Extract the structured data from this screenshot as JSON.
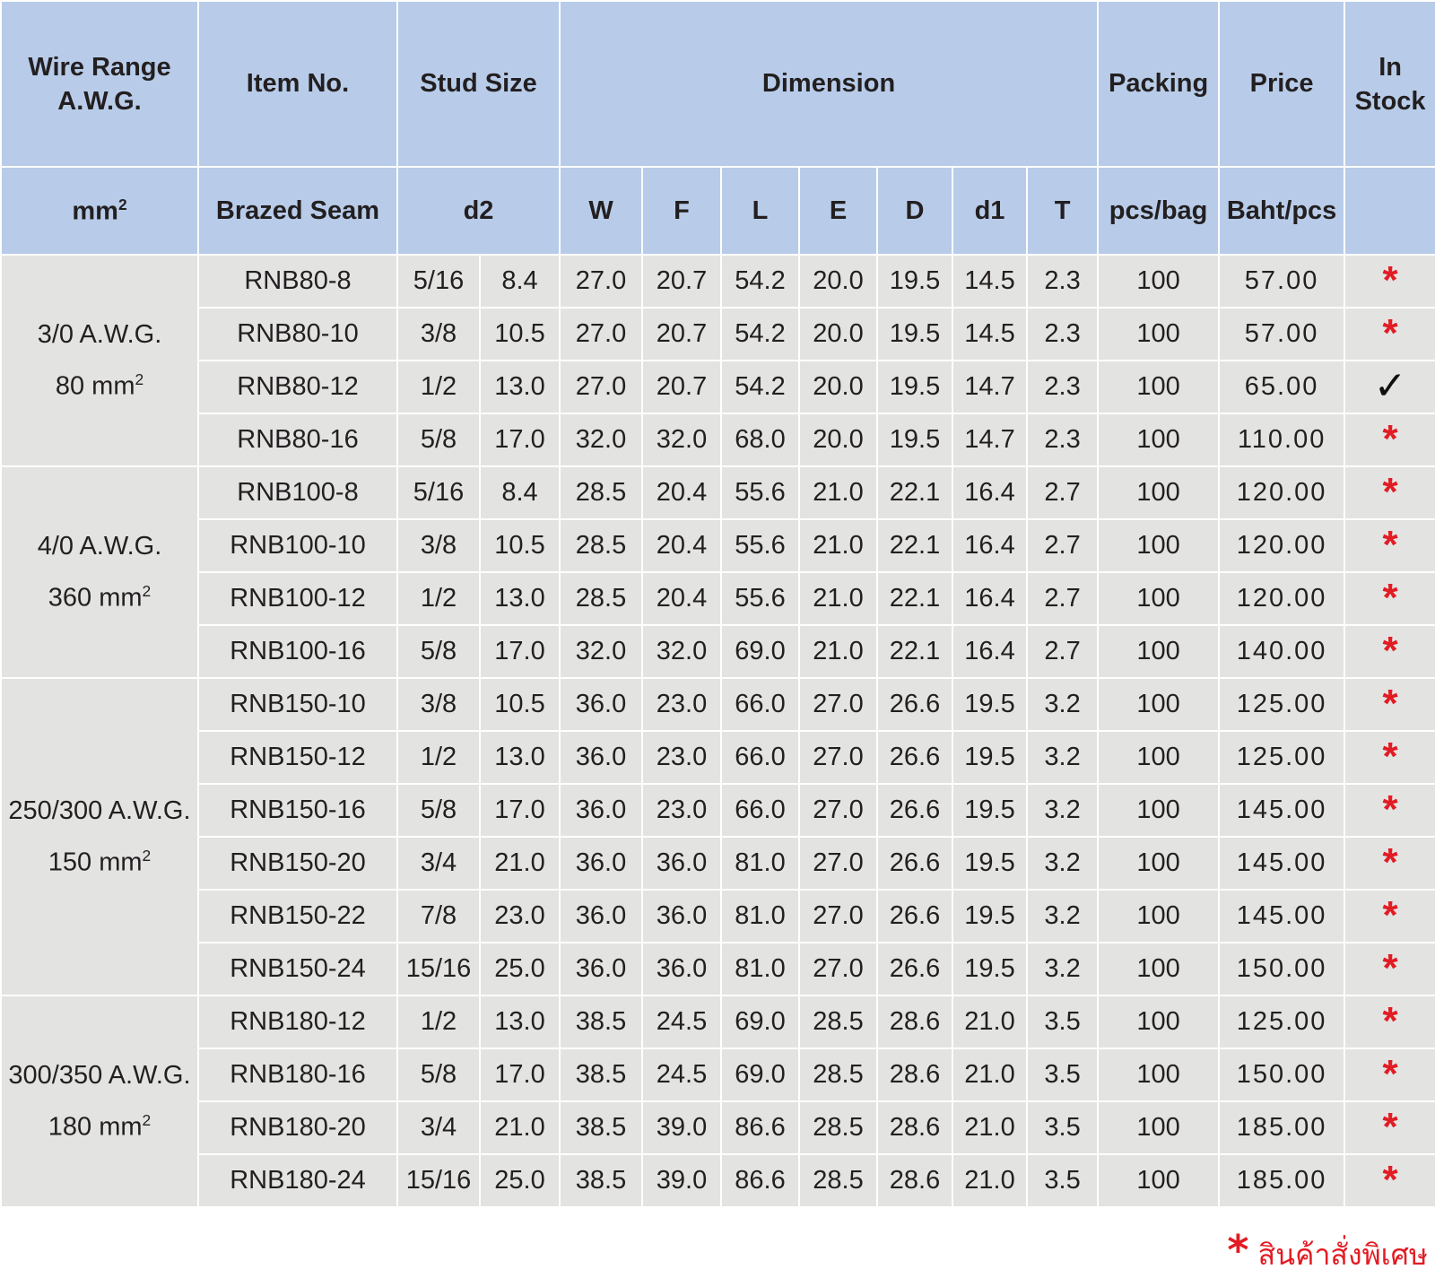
{
  "header1": {
    "wire_range_line1": "Wire Range",
    "wire_range_line2": "A.W.G.",
    "item_no": "Item No.",
    "stud_size": "Stud Size",
    "dimension": "Dimension",
    "packing": "Packing",
    "price": "Price",
    "in_stock_line1": "In",
    "in_stock_line2": "Stock"
  },
  "header2": {
    "mm": "mm",
    "mm_sup": "2",
    "brazed_seam": "Brazed Seam",
    "d2": "d2",
    "W": "W",
    "F": "F",
    "L": "L",
    "E": "E",
    "D": "D",
    "d1": "d1",
    "T": "T",
    "pcs_bag": "pcs/bag",
    "baht_pcs": "Baht/pcs"
  },
  "groups": [
    {
      "awg": "3/0 A.W.G.",
      "mm": "80 mm",
      "sup": "2"
    },
    {
      "awg": "4/0 A.W.G.",
      "mm": "360 mm",
      "sup": "2"
    },
    {
      "awg": "250/300 A.W.G.",
      "mm": "150 mm",
      "sup": "2"
    },
    {
      "awg": "300/350 A.W.G.",
      "mm": "180 mm",
      "sup": "2"
    }
  ],
  "rows": [
    [
      "RNB80-8",
      "5/16",
      "8.4",
      "27.0",
      "20.7",
      "54.2",
      "20.0",
      "19.5",
      "14.5",
      "2.3",
      "100",
      "57.00",
      "*"
    ],
    [
      "RNB80-10",
      "3/8",
      "10.5",
      "27.0",
      "20.7",
      "54.2",
      "20.0",
      "19.5",
      "14.5",
      "2.3",
      "100",
      "57.00",
      "*"
    ],
    [
      "RNB80-12",
      "1/2",
      "13.0",
      "27.0",
      "20.7",
      "54.2",
      "20.0",
      "19.5",
      "14.7",
      "2.3",
      "100",
      "65.00",
      "✓"
    ],
    [
      "RNB80-16",
      "5/8",
      "17.0",
      "32.0",
      "32.0",
      "68.0",
      "20.0",
      "19.5",
      "14.7",
      "2.3",
      "100",
      "110.00",
      "*"
    ],
    [
      "RNB100-8",
      "5/16",
      "8.4",
      "28.5",
      "20.4",
      "55.6",
      "21.0",
      "22.1",
      "16.4",
      "2.7",
      "100",
      "120.00",
      "*"
    ],
    [
      "RNB100-10",
      "3/8",
      "10.5",
      "28.5",
      "20.4",
      "55.6",
      "21.0",
      "22.1",
      "16.4",
      "2.7",
      "100",
      "120.00",
      "*"
    ],
    [
      "RNB100-12",
      "1/2",
      "13.0",
      "28.5",
      "20.4",
      "55.6",
      "21.0",
      "22.1",
      "16.4",
      "2.7",
      "100",
      "120.00",
      "*"
    ],
    [
      "RNB100-16",
      "5/8",
      "17.0",
      "32.0",
      "32.0",
      "69.0",
      "21.0",
      "22.1",
      "16.4",
      "2.7",
      "100",
      "140.00",
      "*"
    ],
    [
      "RNB150-10",
      "3/8",
      "10.5",
      "36.0",
      "23.0",
      "66.0",
      "27.0",
      "26.6",
      "19.5",
      "3.2",
      "100",
      "125.00",
      "*"
    ],
    [
      "RNB150-12",
      "1/2",
      "13.0",
      "36.0",
      "23.0",
      "66.0",
      "27.0",
      "26.6",
      "19.5",
      "3.2",
      "100",
      "125.00",
      "*"
    ],
    [
      "RNB150-16",
      "5/8",
      "17.0",
      "36.0",
      "23.0",
      "66.0",
      "27.0",
      "26.6",
      "19.5",
      "3.2",
      "100",
      "145.00",
      "*"
    ],
    [
      "RNB150-20",
      "3/4",
      "21.0",
      "36.0",
      "36.0",
      "81.0",
      "27.0",
      "26.6",
      "19.5",
      "3.2",
      "100",
      "145.00",
      "*"
    ],
    [
      "RNB150-22",
      "7/8",
      "23.0",
      "36.0",
      "36.0",
      "81.0",
      "27.0",
      "26.6",
      "19.5",
      "3.2",
      "100",
      "145.00",
      "*"
    ],
    [
      "RNB150-24",
      "15/16",
      "25.0",
      "36.0",
      "36.0",
      "81.0",
      "27.0",
      "26.6",
      "19.5",
      "3.2",
      "100",
      "150.00",
      "*"
    ],
    [
      "RNB180-12",
      "1/2",
      "13.0",
      "38.5",
      "24.5",
      "69.0",
      "28.5",
      "28.6",
      "21.0",
      "3.5",
      "100",
      "125.00",
      "*"
    ],
    [
      "RNB180-16",
      "5/8",
      "17.0",
      "38.5",
      "24.5",
      "69.0",
      "28.5",
      "28.6",
      "21.0",
      "3.5",
      "100",
      "150.00",
      "*"
    ],
    [
      "RNB180-20",
      "3/4",
      "21.0",
      "38.5",
      "39.0",
      "86.6",
      "28.5",
      "28.6",
      "21.0",
      "3.5",
      "100",
      "185.00",
      "*"
    ],
    [
      "RNB180-24",
      "15/16",
      "25.0",
      "38.5",
      "39.0",
      "86.6",
      "28.5",
      "28.6",
      "21.0",
      "3.5",
      "100",
      "185.00",
      "*"
    ]
  ],
  "footnote": {
    "star": "*",
    "text": "สินค้าสั่งพิเศษ"
  },
  "colors": {
    "header_bg": "#b8cce9",
    "row_bg": "#e3e3e2",
    "star": "#e31b23"
  }
}
